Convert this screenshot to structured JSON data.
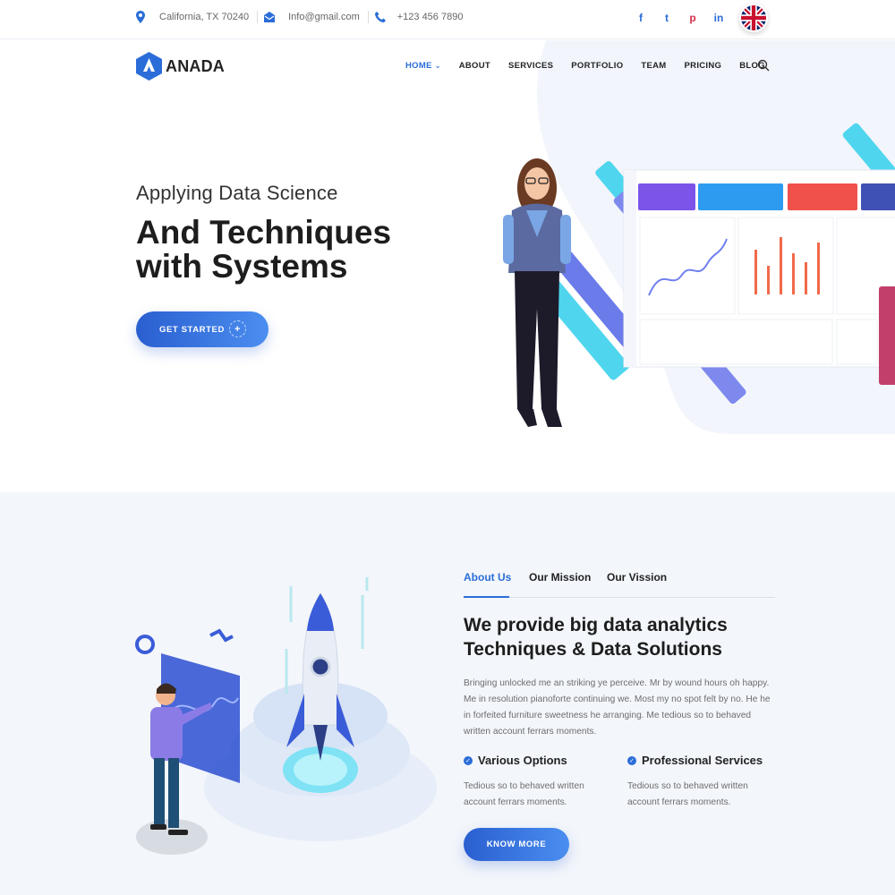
{
  "topbar": {
    "address": "California, TX 70240",
    "email": "Info@gmail.com",
    "phone": "+123 456 7890",
    "social": [
      {
        "icon": "facebook-icon",
        "glyph": "f"
      },
      {
        "icon": "twitter-icon",
        "glyph": "t"
      },
      {
        "icon": "pinterest-icon",
        "glyph": "p"
      },
      {
        "icon": "linkedin-icon",
        "glyph": "in"
      }
    ],
    "language_flag": "uk-flag-icon"
  },
  "brand": {
    "name": "ANADA"
  },
  "nav": {
    "items": [
      {
        "label": "HOME",
        "active": true
      },
      {
        "label": "ABOUT"
      },
      {
        "label": "SERVICES"
      },
      {
        "label": "PORTFOLIO"
      },
      {
        "label": "TEAM"
      },
      {
        "label": "PRICING"
      },
      {
        "label": "BLOG"
      }
    ],
    "search_icon": "search-icon"
  },
  "hero": {
    "subtitle": "Applying Data Science",
    "title": "And Techniques with Systems",
    "cta_label": "GET STARTED",
    "cta_icon": "plus-icon"
  },
  "about": {
    "tabs": [
      {
        "label": "About Us",
        "active": true
      },
      {
        "label": "Our Mission"
      },
      {
        "label": "Our Vission"
      }
    ],
    "heading": "We provide big data analytics Techniques & Data Solutions",
    "paragraph": "Bringing unlocked me an striking ye perceive. Mr by wound hours oh happy. Me in resolution pianoforte continuing we. Most my no spot felt by no. He he in forfeited furniture sweetness he arranging. Me tedious so to behaved written account ferrars moments.",
    "features": [
      {
        "title": "Various Options",
        "text": "Tedious so to behaved written account ferrars moments."
      },
      {
        "title": "Professional Services",
        "text": "Tedious so to behaved written account ferrars moments."
      }
    ],
    "cta_label": "KNOW MORE"
  },
  "colors": {
    "accent": "#2a6dd8",
    "dark_text": "#1d1d1d",
    "muted_text": "#6d6d6d",
    "section_bg": "#f3f6fb"
  }
}
